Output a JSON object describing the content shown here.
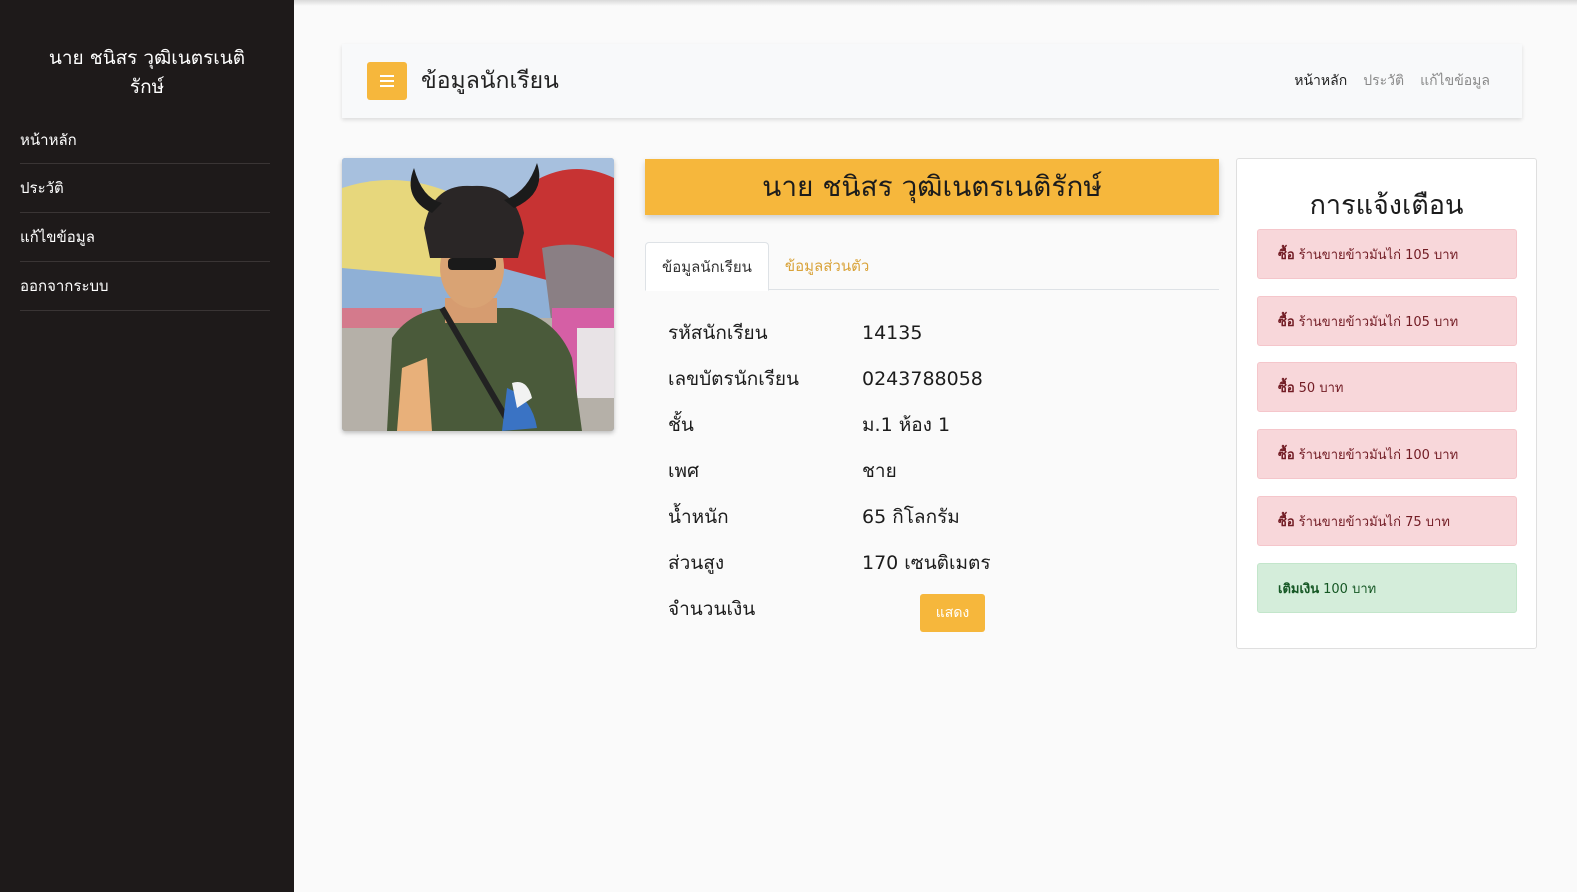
{
  "sidebar": {
    "title": "นาย ชนิสร วุฒิเนตรเนติรักษ์",
    "items": [
      {
        "label": "หน้าหลัก"
      },
      {
        "label": "ประวัติ"
      },
      {
        "label": "แก้ไขข้อมูล"
      },
      {
        "label": "ออกจากระบบ"
      }
    ]
  },
  "navbar": {
    "title": "ข้อมูลนักเรียน",
    "toggle_icon": "hamburger-icon",
    "links": [
      {
        "label": "หน้าหลัก",
        "active": true
      },
      {
        "label": "ประวัติ",
        "active": false
      },
      {
        "label": "แก้ไขข้อมูล",
        "active": false
      }
    ]
  },
  "profile": {
    "name": "นาย ชนิสร วุฒิเนตรเนติรักษ์",
    "tabs": [
      {
        "label": "ข้อมูลนักเรียน",
        "active": true
      },
      {
        "label": "ข้อมูลส่วนตัว",
        "active": false
      }
    ],
    "fields": [
      {
        "label": "รหัสนักเรียน",
        "value": "14135"
      },
      {
        "label": "เลขบัตรนักเรียน",
        "value": "0243788058"
      },
      {
        "label": "ชั้น",
        "value": "ม.1 ห้อง 1"
      },
      {
        "label": "เพศ",
        "value": "ชาย"
      },
      {
        "label": "น้ำหนัก",
        "value": "65 กิโลกรัม"
      },
      {
        "label": "ส่วนสูง",
        "value": "170 เซนติเมตร"
      }
    ],
    "balance_label": "จำนวนเงิน",
    "show_button": "แสดง"
  },
  "alerts": {
    "title": "การแจ้งเตือน",
    "items": [
      {
        "type": "danger",
        "kind": "ซื้อ",
        "text": "ร้านขายข้าวมันไก่ 105 บาท"
      },
      {
        "type": "danger",
        "kind": "ซื้อ",
        "text": "ร้านขายข้าวมันไก่ 105 บาท"
      },
      {
        "type": "danger",
        "kind": "ซื้อ",
        "text": "50 บาท"
      },
      {
        "type": "danger",
        "kind": "ซื้อ",
        "text": "ร้านขายข้าวมันไก่ 100 บาท"
      },
      {
        "type": "danger",
        "kind": "ซื้อ",
        "text": "ร้านขายข้าวมันไก่ 75 บาท"
      },
      {
        "type": "success",
        "kind": "เติมเงิน",
        "text": "100 บาท"
      }
    ]
  },
  "colors": {
    "sidebar_bg": "#1e1a1a",
    "accent": "#f6b73c",
    "danger_bg": "#f8d7da",
    "success_bg": "#d4edda"
  }
}
